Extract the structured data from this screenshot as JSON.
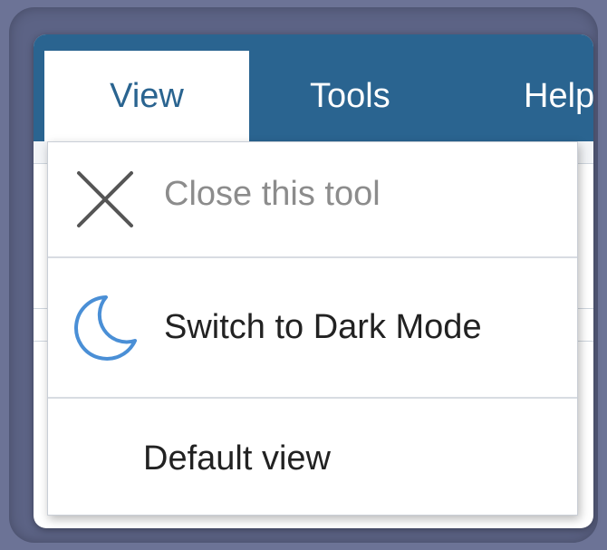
{
  "menubar": {
    "tabs": [
      {
        "label": "View",
        "active": true
      },
      {
        "label": "Tools",
        "active": false
      },
      {
        "label": "Help",
        "active": false
      }
    ]
  },
  "view_menu": {
    "items": [
      {
        "label": "Close this tool",
        "icon": "close-icon",
        "enabled": false
      },
      {
        "label": "Switch to Dark Mode",
        "icon": "moon-icon",
        "enabled": true
      },
      {
        "label": "Default view",
        "icon": null,
        "enabled": true
      }
    ]
  },
  "colors": {
    "menubar": "#2a6490",
    "moon_icon": "#4a8fd6",
    "disabled_text": "#8c8c8c"
  }
}
